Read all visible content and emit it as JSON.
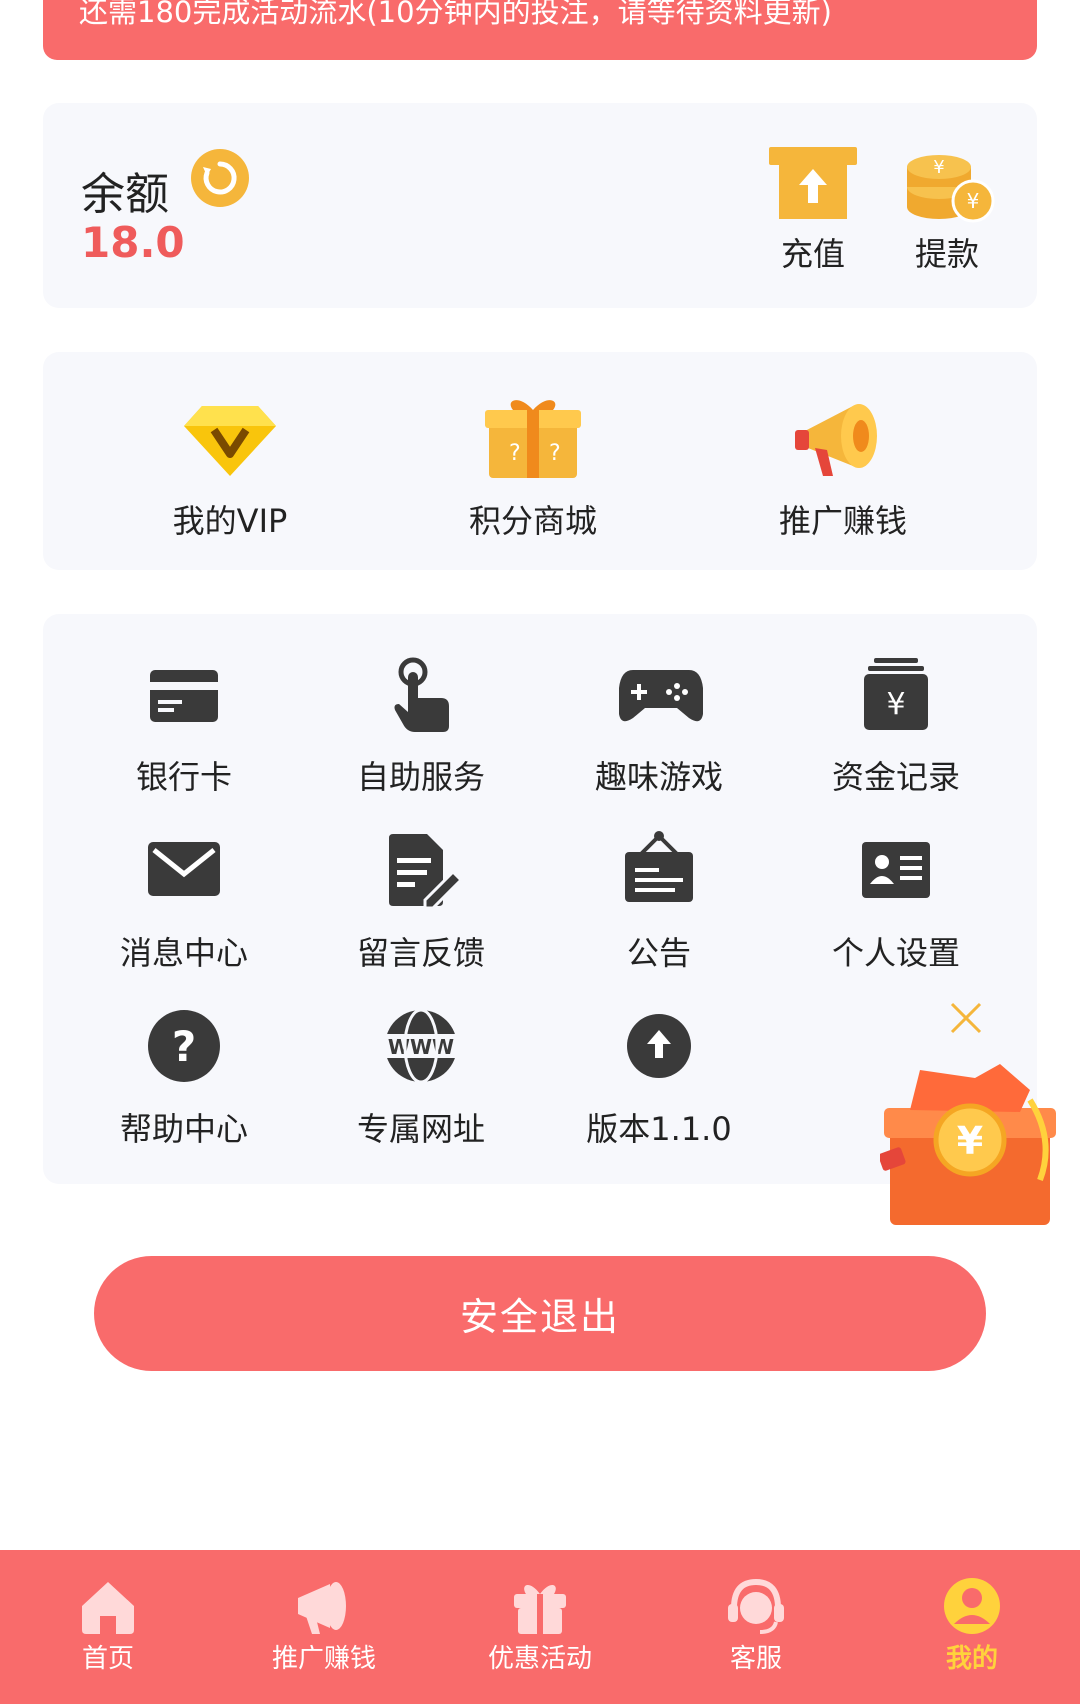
{
  "notice": {
    "text": "还需180完成活动流水(10分钟内的投注，请等待资料更新)"
  },
  "balance": {
    "label": "余额",
    "value": "18.0",
    "actions": [
      {
        "label": "充值",
        "icon": "deposit-icon"
      },
      {
        "label": "提款",
        "icon": "withdraw-coins-icon"
      }
    ]
  },
  "quick_links": [
    {
      "label": "我的VIP",
      "icon": "vip-diamond-icon"
    },
    {
      "label": "积分商城",
      "icon": "gift-box-icon"
    },
    {
      "label": "推广赚钱",
      "icon": "megaphone-icon"
    }
  ],
  "menu": [
    {
      "label": "银行卡",
      "icon": "bank-card-icon"
    },
    {
      "label": "自助服务",
      "icon": "tap-hand-icon"
    },
    {
      "label": "趣味游戏",
      "icon": "gamepad-icon"
    },
    {
      "label": "资金记录",
      "icon": "money-record-icon"
    },
    {
      "label": "消息中心",
      "icon": "envelope-icon"
    },
    {
      "label": "留言反馈",
      "icon": "feedback-edit-icon"
    },
    {
      "label": "公告",
      "icon": "notice-board-icon"
    },
    {
      "label": "个人设置",
      "icon": "id-card-icon"
    },
    {
      "label": "帮助中心",
      "icon": "help-question-icon"
    },
    {
      "label": "专属网址",
      "icon": "www-globe-icon"
    },
    {
      "label": "版本1.1.0",
      "icon": "upload-arrow-icon"
    }
  ],
  "logout": {
    "label": "安全退出"
  },
  "tabs": [
    {
      "label": "首页",
      "icon": "home-icon"
    },
    {
      "label": "推广赚钱",
      "icon": "megaphone-icon"
    },
    {
      "label": "优惠活动",
      "icon": "gift-icon"
    },
    {
      "label": "客服",
      "icon": "customer-service-icon"
    },
    {
      "label": "我的",
      "icon": "user-icon",
      "active": true
    }
  ],
  "colors": {
    "primary": "#f96b6b",
    "balance": "#ef5b5b",
    "gold": "#f5b63b",
    "active_tab": "#ffd23c",
    "icon_dark": "#3a3a3a"
  }
}
